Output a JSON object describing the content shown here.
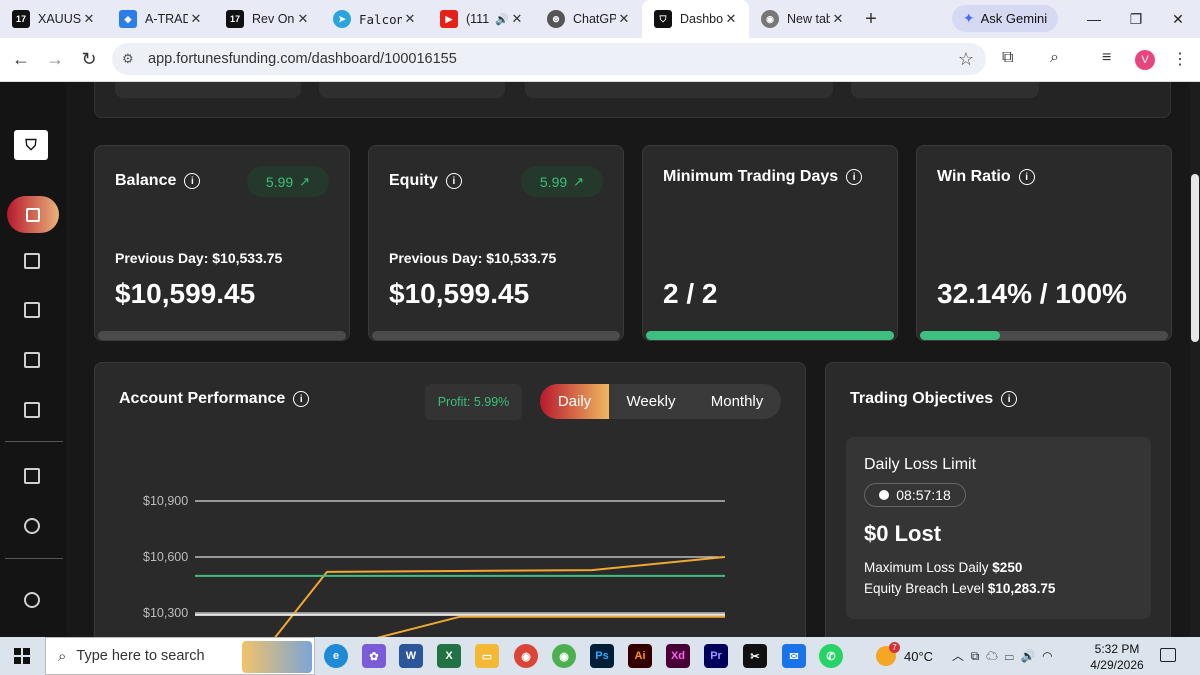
{
  "browser": {
    "tabs": [
      {
        "title": "XAUUSD",
        "fav": "17",
        "fav_color": "#111111"
      },
      {
        "title": "A-TRADE",
        "fav": "◆",
        "fav_color": "#2b7de9"
      },
      {
        "title": "Rev One",
        "fav": "17",
        "fav_color": "#111111"
      },
      {
        "title": "Falcon",
        "fav": "➤",
        "fav_color": "#2aa3df"
      },
      {
        "title": "(111",
        "fav": "▶",
        "fav_color": "#e62117"
      },
      {
        "title": "ChatGPT",
        "fav": "⊛",
        "fav_color": "#555555"
      },
      {
        "title": "Dashbo",
        "fav": "⛉",
        "fav_color": "#111111"
      },
      {
        "title": "New tab",
        "fav": "◉",
        "fav_color": "#777777"
      }
    ],
    "ask_gemini": "Ask Gemini",
    "url": "app.fortunesfunding.com/dashboard/100016155",
    "avatar_letter": "V"
  },
  "cards": {
    "balance": {
      "title": "Balance",
      "badge": "5.99",
      "previous": "Previous Day: $10,533.75",
      "value": "$10,599.45"
    },
    "equity": {
      "title": "Equity",
      "badge": "5.99",
      "previous": "Previous Day: $10,533.75",
      "value": "$10,599.45"
    },
    "min_days": {
      "title": "Minimum Trading Days",
      "value": "2 / 2",
      "progress": 1.0
    },
    "win_ratio": {
      "title": "Win Ratio",
      "value": "32.14% / 100%",
      "progress": 0.3214
    }
  },
  "performance": {
    "title": "Account Performance",
    "profit": "Profit: 5.99%",
    "tabs": [
      "Daily",
      "Weekly",
      "Monthly"
    ],
    "active_tab": "Daily"
  },
  "chart_data": {
    "type": "line",
    "y_ticks": [
      "$10,900",
      "$10,600",
      "$10,300"
    ],
    "ylim": [
      10300,
      10900
    ],
    "series": [
      {
        "values": [
          10000,
          10520,
          10530,
          10600
        ],
        "color": "#f0a830"
      },
      {
        "values": [
          10499,
          10499,
          10499,
          10499
        ],
        "color": "#3fbf7f"
      },
      {
        "values": [
          10290,
          10290,
          10290,
          10290
        ],
        "color": "#e8e8e8"
      },
      {
        "values": [
          10000,
          10280,
          10280,
          10280
        ],
        "color": "#f0a830"
      }
    ]
  },
  "objectives": {
    "title": "Trading Objectives",
    "daily_loss": {
      "heading": "Daily Loss Limit",
      "timer": "08:57:18",
      "lost": "$0 Lost",
      "max_loss_label": "Maximum Loss Daily",
      "max_loss_value": "$250",
      "breach_label": "Equity Breach Level",
      "breach_value": "$10,283.75"
    }
  },
  "taskbar": {
    "search_placeholder": "Type here to search",
    "weather_temp": "40°C",
    "weather_badge": "7",
    "time": "5:32 PM",
    "date": "4/29/2026"
  },
  "colors": {
    "accent_green": "#3fbf7f",
    "accent_red": "#b8192e",
    "accent_gold": "#f0b860"
  }
}
